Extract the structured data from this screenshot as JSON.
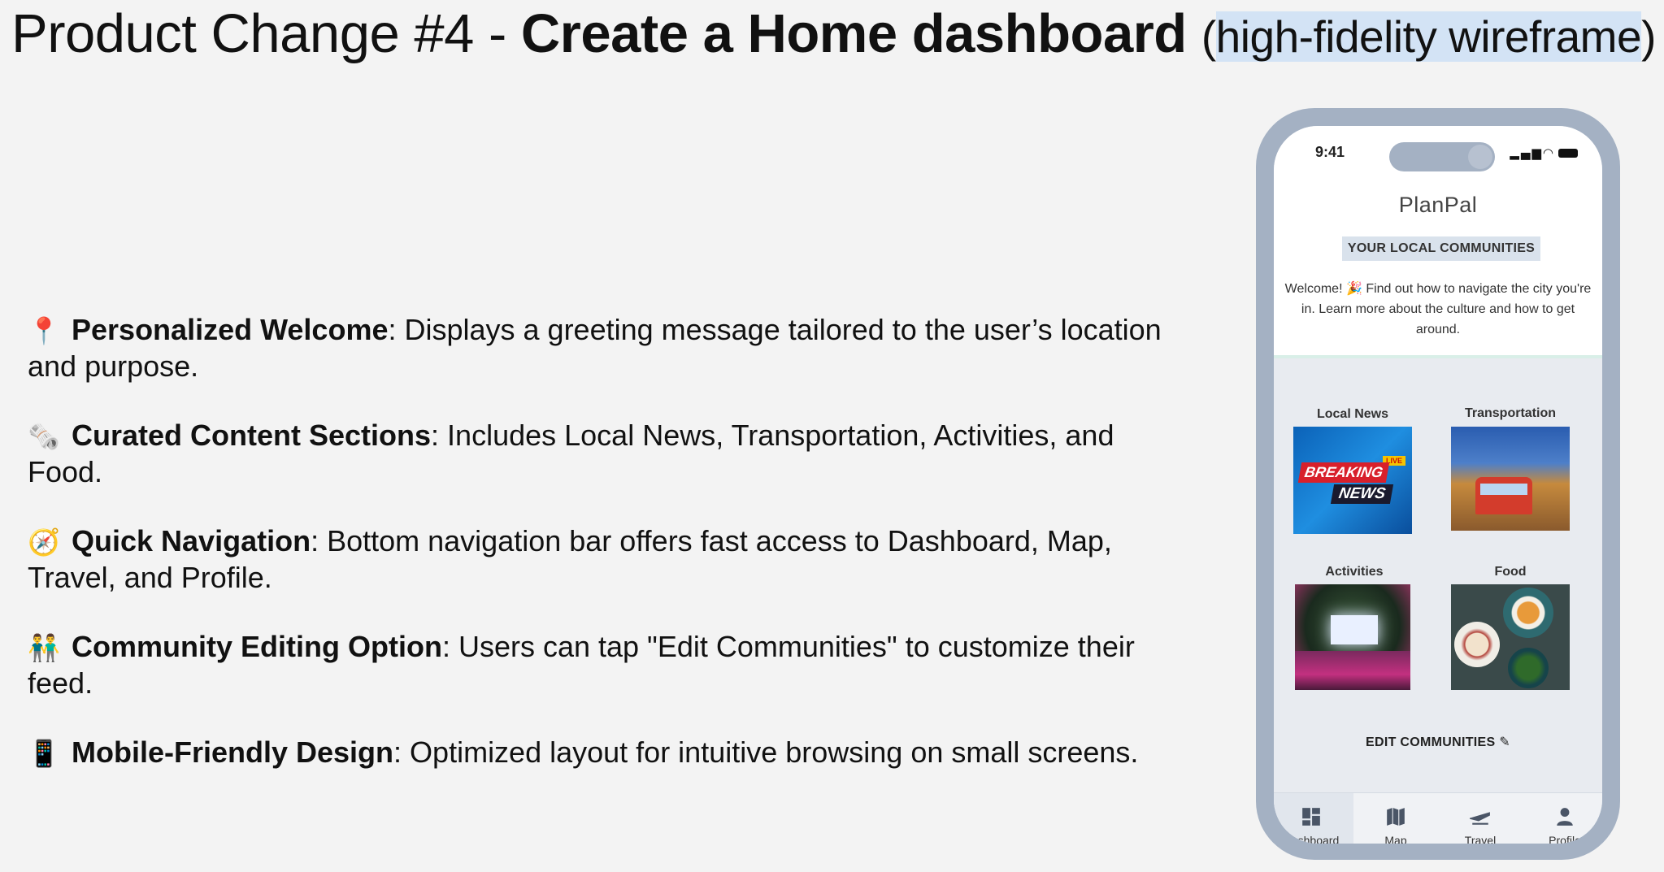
{
  "slide": {
    "title_prefix": "Product Change #4 - ",
    "title_bold": "Create a Home dashboard",
    "title_paren_open": "(",
    "title_highlight": "high-fidelity wireframe",
    "title_paren_close": ")"
  },
  "features": [
    {
      "emoji": "📍",
      "icon": "pin-icon",
      "title": "Personalized Welcome",
      "text": ": Displays a greeting message tailored to the user’s location and purpose."
    },
    {
      "emoji": "🗞️",
      "icon": "newspaper-icon",
      "title": "Curated Content Sections",
      "text": ": Includes Local News, Transportation, Activities, and Food."
    },
    {
      "emoji": "🧭",
      "icon": "compass-icon",
      "title": "Quick Navigation",
      "text": ": Bottom navigation bar offers fast access to Dashboard, Map, Travel, and Profile."
    },
    {
      "emoji": "👬",
      "icon": "people-icon",
      "title": "Community Editing Option",
      "text": ": Users can tap \"Edit Communities\" to customize their feed."
    },
    {
      "emoji": "📱",
      "icon": "mobile-phone-icon",
      "title": "Mobile-Friendly Design",
      "text": ": Optimized layout for intuitive browsing on small screens."
    }
  ],
  "phone": {
    "time": "9:41",
    "app_name": "PlanPal",
    "section_title": "YOUR LOCAL COMMUNITIES",
    "welcome": "Welcome! 🎉 Find out how to navigate the city you're in. Learn more about the culture and how to get around.",
    "tiles": [
      {
        "label": "Local News",
        "image_text": {
          "breaking": "BREAKING",
          "news": "NEWS",
          "live": "LIVE"
        }
      },
      {
        "label": "Transportation"
      },
      {
        "label": "Activities"
      },
      {
        "label": "Food"
      }
    ],
    "edit_link": "EDIT COMMUNITIES",
    "nav": [
      {
        "label": "Dashboard",
        "icon": "dashboard-icon",
        "active": true
      },
      {
        "label": "Map",
        "icon": "map-icon",
        "active": false
      },
      {
        "label": "Travel",
        "icon": "plane-icon",
        "active": false
      },
      {
        "label": "Profile",
        "icon": "profile-icon",
        "active": false
      }
    ]
  },
  "colors": {
    "background": "#f3f3f3",
    "phone_frame": "#a4b1c3",
    "highlight": "#d3e3f5",
    "accent_mint": "#d9efe8"
  }
}
